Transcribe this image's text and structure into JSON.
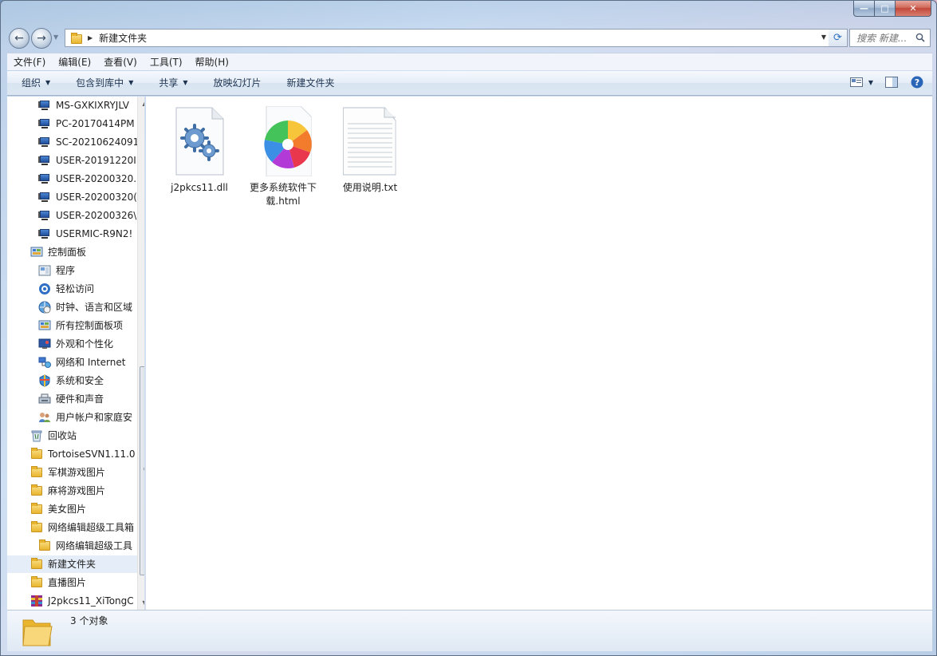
{
  "window": {
    "caption": {
      "minimize": "—",
      "maximize": "□",
      "close": "✕"
    }
  },
  "address_bar": {
    "path": "新建文件夹",
    "search_placeholder": "搜索 新建..."
  },
  "menu": [
    "文件(F)",
    "编辑(E)",
    "查看(V)",
    "工具(T)",
    "帮助(H)"
  ],
  "toolbar": {
    "items": [
      {
        "label": "组织",
        "dropdown": true
      },
      {
        "label": "包含到库中",
        "dropdown": true
      },
      {
        "label": "共享",
        "dropdown": true
      },
      {
        "label": "放映幻灯片",
        "dropdown": false
      },
      {
        "label": "新建文件夹",
        "dropdown": false
      }
    ]
  },
  "nav_pane": {
    "items": [
      {
        "label": "MS-GXKIXRYJLV",
        "icon": "computer-icon",
        "indent": 2
      },
      {
        "label": "PC-20170414PM",
        "icon": "computer-icon",
        "indent": 2
      },
      {
        "label": "SC-20210624091",
        "icon": "computer-icon",
        "indent": 2
      },
      {
        "label": "USER-20191220I",
        "icon": "computer-icon",
        "indent": 2
      },
      {
        "label": "USER-20200320.",
        "icon": "computer-icon",
        "indent": 2
      },
      {
        "label": "USER-20200320(",
        "icon": "computer-icon",
        "indent": 2
      },
      {
        "label": "USER-20200326\\",
        "icon": "computer-icon",
        "indent": 2
      },
      {
        "label": "USERMIC-R9N2!",
        "icon": "computer-icon",
        "indent": 2
      },
      {
        "label": "控制面板",
        "icon": "control-panel-icon",
        "indent": 1
      },
      {
        "label": "程序",
        "icon": "programs-icon",
        "indent": 2
      },
      {
        "label": "轻松访问",
        "icon": "ease-of-access-icon",
        "indent": 2
      },
      {
        "label": "时钟、语言和区域",
        "icon": "clock-language-icon",
        "indent": 2
      },
      {
        "label": "所有控制面板项",
        "icon": "control-panel-icon",
        "indent": 2
      },
      {
        "label": "外观和个性化",
        "icon": "appearance-icon",
        "indent": 2
      },
      {
        "label": "网络和 Internet",
        "icon": "network-icon",
        "indent": 2
      },
      {
        "label": "系统和安全",
        "icon": "system-security-icon",
        "indent": 2
      },
      {
        "label": "硬件和声音",
        "icon": "hardware-sound-icon",
        "indent": 2
      },
      {
        "label": "用户帐户和家庭安",
        "icon": "user-accounts-icon",
        "indent": 2
      },
      {
        "label": "回收站",
        "icon": "recycle-bin-icon",
        "indent": 1
      },
      {
        "label": "TortoiseSVN1.11.0",
        "icon": "folder-icon",
        "indent": 1
      },
      {
        "label": "军棋游戏图片",
        "icon": "folder-icon",
        "indent": 1
      },
      {
        "label": "麻将游戏图片",
        "icon": "folder-icon",
        "indent": 1
      },
      {
        "label": "美女图片",
        "icon": "folder-icon",
        "indent": 1
      },
      {
        "label": "网络编辑超级工具箱",
        "icon": "folder-icon",
        "indent": 1
      },
      {
        "label": "网络编辑超级工具",
        "icon": "folder-icon",
        "indent": 2
      },
      {
        "label": "新建文件夹",
        "icon": "folder-icon",
        "indent": 1,
        "selected": true
      },
      {
        "label": "直播图片",
        "icon": "folder-icon",
        "indent": 1
      },
      {
        "label": "J2pkcs11_XiTongC",
        "icon": "archive-icon",
        "indent": 1
      }
    ]
  },
  "files": [
    {
      "name": "j2pkcs11.dll",
      "icon": "dll-gear-icon"
    },
    {
      "name": "更多系统软件下载.html",
      "icon": "browser-html-icon"
    },
    {
      "name": "使用说明.txt",
      "icon": "text-file-icon"
    }
  ],
  "status": {
    "text": "3 个对象"
  },
  "colors": {
    "selection": "#e5eef8",
    "toolbar_text": "#1e3451"
  }
}
